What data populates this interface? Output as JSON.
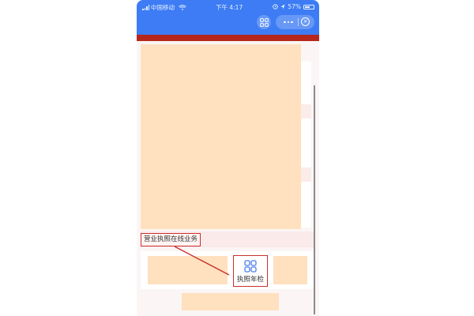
{
  "status_bar": {
    "carrier": "中国移动",
    "time": "下午 4:17",
    "battery": "57%"
  },
  "header": {
    "scan_icon": "grid-scan-icon",
    "more_icon": "more-dots-icon",
    "close_icon": "close-circle-icon"
  },
  "section": {
    "title": "营业执照在线业务"
  },
  "grid": {
    "items": [
      {
        "label": "执照年检",
        "icon": "four-squares-icon"
      }
    ]
  },
  "colors": {
    "header_blue": "#3d7cf4",
    "banner_red": "#b5271c",
    "highlight_red": "#c9302c",
    "placeholder_peach": "#ffe0bf",
    "icon_blue": "#4a7de8"
  }
}
